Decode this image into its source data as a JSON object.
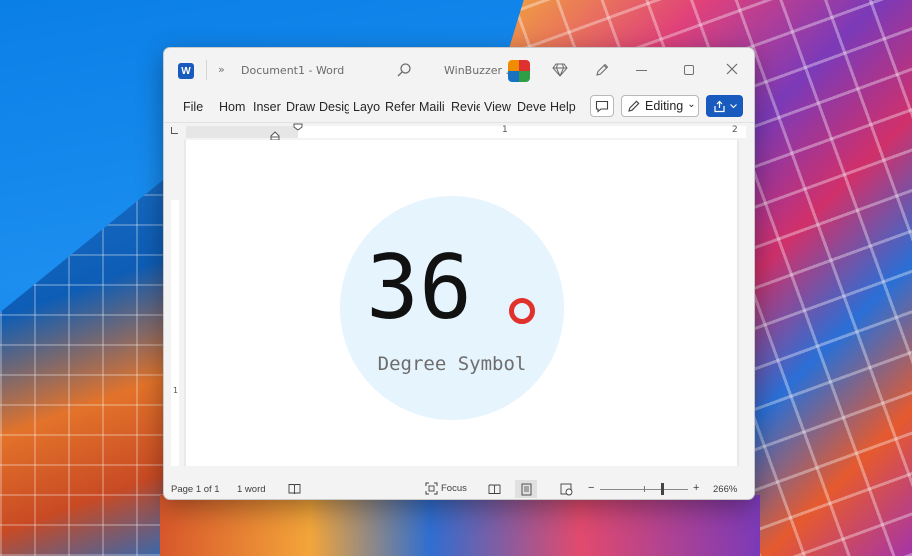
{
  "titlebar": {
    "app_logo": "W",
    "qat_more": "»",
    "document_title": "Document1  -  Word",
    "user_name": "WinBuzzer .",
    "icons": [
      "word-logo-icon",
      "search-icon",
      "avatar",
      "diamond-icon",
      "pen-icon",
      "minimize-icon",
      "maximize-icon",
      "close-icon"
    ]
  },
  "ribbon": {
    "tabs": [
      {
        "id": "file",
        "label": "File"
      },
      {
        "id": "home",
        "label": "Hom"
      },
      {
        "id": "insert",
        "label": "Inser"
      },
      {
        "id": "draw",
        "label": "Draw"
      },
      {
        "id": "design",
        "label": "Desig"
      },
      {
        "id": "layout",
        "label": "Layo"
      },
      {
        "id": "references",
        "label": "Refer"
      },
      {
        "id": "mailings",
        "label": "Maili"
      },
      {
        "id": "review",
        "label": "Revie"
      },
      {
        "id": "view",
        "label": "View"
      },
      {
        "id": "developer",
        "label": "Deve"
      },
      {
        "id": "help",
        "label": "Help"
      }
    ],
    "editing_label": "Editing",
    "editing_caret": "⌄"
  },
  "ruler": {
    "label_1": "1",
    "label_2": "2"
  },
  "vruler": {
    "label_1": "1"
  },
  "document": {
    "number": "36",
    "caption": "Degree Symbol",
    "accent_color": "#e0312b",
    "circle_color": "#e6f4fd"
  },
  "status": {
    "page": "Page 1 of 1",
    "words": "1 word",
    "focus_label": "Focus",
    "zoom_minus": "−",
    "zoom_plus": "+",
    "zoom_level": "266%"
  }
}
